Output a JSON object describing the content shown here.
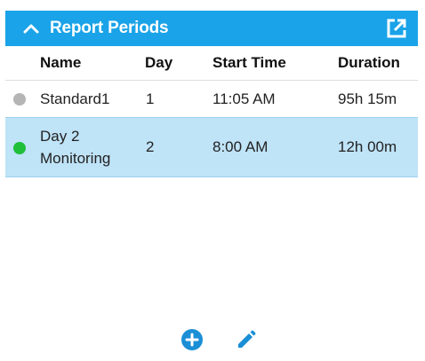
{
  "header": {
    "title": "Report Periods",
    "collapse_icon": "chevron-up-icon",
    "popout_icon": "open-external-icon",
    "background_color": "#1aa3e8"
  },
  "table": {
    "columns": [
      "Name",
      "Day",
      "Start Time",
      "Duration"
    ],
    "rows": [
      {
        "name": "Standard1",
        "day": "1",
        "start_time": "11:05 AM",
        "duration": "95h 15m",
        "status_color": "#b5b5b5",
        "selected": false
      },
      {
        "name": "Day 2 Monitoring",
        "day": "2",
        "start_time": "8:00 AM",
        "duration": "12h 00m",
        "status_color": "#1fbf3a",
        "selected": true
      }
    ],
    "selected_row_color": "#bfe3f7"
  },
  "footer": {
    "add_icon": "add-circle-icon",
    "edit_icon": "pencil-icon",
    "accent_color": "#1a8fd6"
  }
}
